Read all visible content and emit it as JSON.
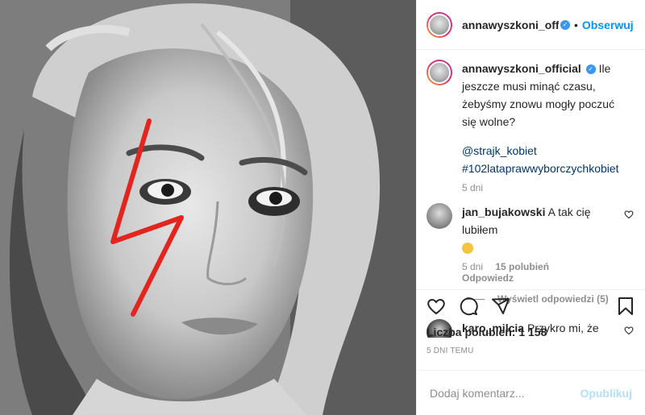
{
  "post": {
    "username": "annawyszkoni_official",
    "header_username": "annawyszkoni_officia",
    "follow_label": "Obserwuj",
    "dot": "•",
    "verified_icon": "verified-badge-icon",
    "accent_color": "#0095f6",
    "lightning_color": "#e2261f"
  },
  "caption": {
    "text": "Ile jeszcze musi minąć czasu, żebyśmy znowu mogły poczuć się wolne?",
    "tag_user": "@strajk_kobiet",
    "hashtag": "#102lataprawwyborczychkobiet",
    "time": "5 dni"
  },
  "comments": [
    {
      "username": "jan_bujakowski",
      "text": "A tak cię lubiłem",
      "emoji": "thinking-face-emoji",
      "time": "5 dni",
      "likes": "15 polubień",
      "reply_label": "Odpowiedz",
      "view_replies": "Wyświetl odpowiedzi (5)"
    },
    {
      "username": "karo_milcia",
      "text": "Przykro mi, że popiera Pani aborcję na życzenie, bo przecież o to teraz walczą te kobiety, a Pani to"
    }
  ],
  "actions": {
    "like_icon": "heart-icon",
    "comment_icon": "comment-icon",
    "share_icon": "share-icon",
    "save_icon": "bookmark-icon",
    "likes_label": "Liczba polubień: 1 158",
    "date": "5 DNI TEMU"
  },
  "composer": {
    "placeholder": "Dodaj komentarz...",
    "publish_label": "Opublikuj"
  }
}
